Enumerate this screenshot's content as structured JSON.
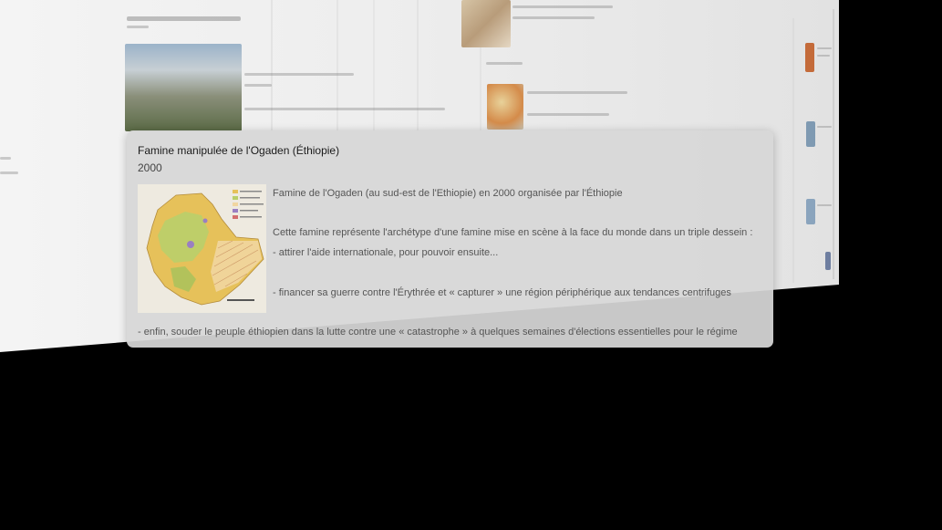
{
  "popup": {
    "title": "Famine manipulée de l'Ogaden (Éthiopie)",
    "date": "2000",
    "image_alt": "Carte de l'Éthiopie",
    "paragraphs": [
      "Famine de l'Ogaden (au sud-est de l'Ethiopie) en 2000 organisée par l'Éthiopie",
      "Cette famine représente l'archétype d'une famine mise en scène à la face du monde dans un triple dessein :",
      "- attirer l'aide internationale, pour pouvoir ensuite...",
      "- financer sa guerre contre l'Érythrée et « capturer » une région périphérique aux tendances centrifuges",
      "- enfin, souder le peuple éthiopien dans la lutte contre une « catastrophe » à quelques semaines d'élections essentielles pour le régime"
    ]
  },
  "colors": {
    "wall": "#ececec",
    "popup_bg": "#d7d7d7",
    "map_yellow": "#e6c15a",
    "map_green": "#b9cf6a"
  }
}
